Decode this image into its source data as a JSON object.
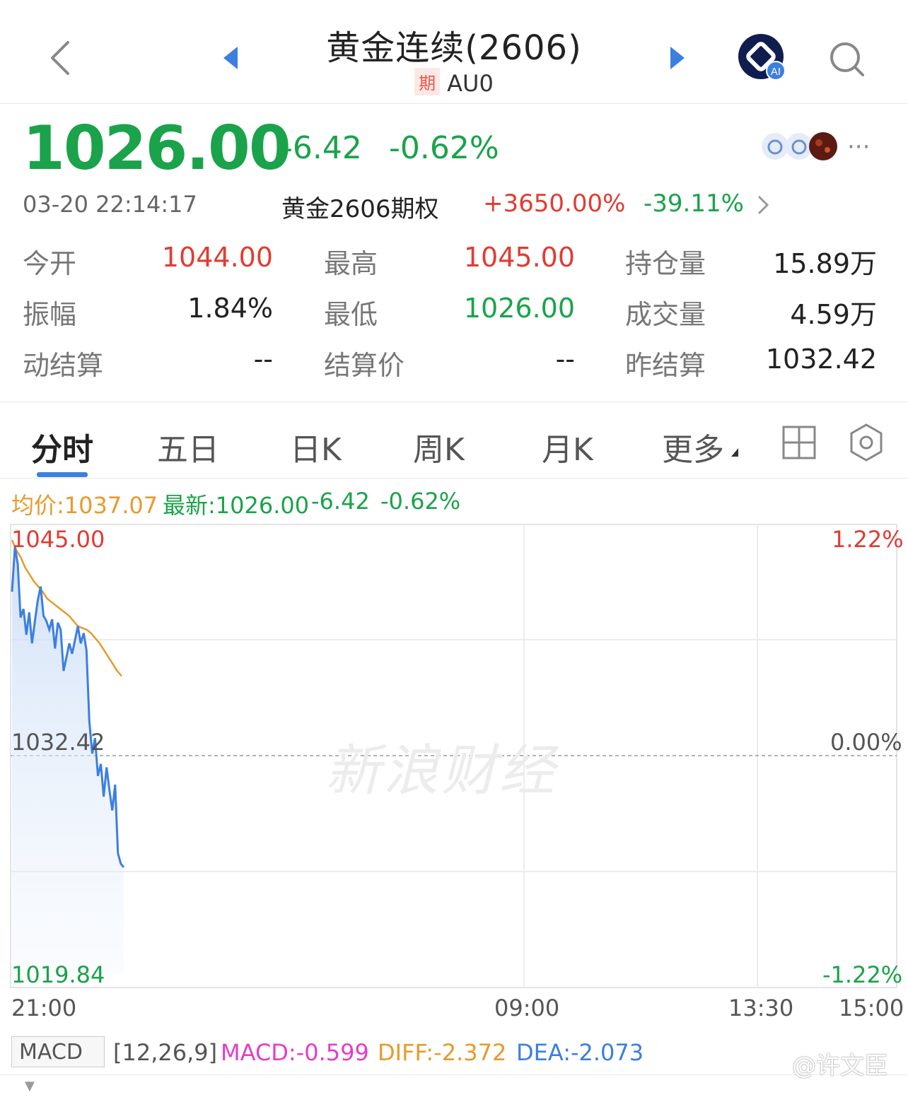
{
  "header": {
    "title": "黄金连续(2606)",
    "badge": "期",
    "code": "AU0"
  },
  "quote": {
    "price": "1026.00",
    "change": "-6.42",
    "change_pct": "-0.62%",
    "time": "03-20 22:14:17",
    "option_name": "黄金2606期权",
    "option_up": "+3650.00%",
    "option_down": "-39.11%"
  },
  "stats": [
    {
      "label": "今开",
      "value": "1044.00",
      "color": "#e23b32"
    },
    {
      "label": "最高",
      "value": "1045.00",
      "color": "#e23b32"
    },
    {
      "label": "持仓量",
      "value": "15.89万",
      "color": "#222222"
    },
    {
      "label": "振幅",
      "value": "1.84%",
      "color": "#222222"
    },
    {
      "label": "最低",
      "value": "1026.00",
      "color": "#1aa34a"
    },
    {
      "label": "成交量",
      "value": "4.59万",
      "color": "#222222"
    },
    {
      "label": "动结算",
      "value": "--",
      "color": "#222222"
    },
    {
      "label": "结算价",
      "value": "--",
      "color": "#222222"
    },
    {
      "label": "昨结算",
      "value": "1032.42",
      "color": "#222222"
    }
  ],
  "tabs": [
    "分时",
    "五日",
    "日K",
    "周K",
    "月K",
    "更多"
  ],
  "legend": {
    "avg": "均价:1037.07",
    "latest": "最新:1026.00",
    "change": "-6.42",
    "change_pct": "-0.62%"
  },
  "axis": {
    "top_price": "1045.00",
    "mid_price": "1032.42",
    "bottom_price": "1019.84",
    "top_pct": "1.22%",
    "mid_pct": "0.00%",
    "bottom_pct": "-1.22%",
    "times": [
      "21:00",
      "09:00",
      "13:30",
      "15:00"
    ]
  },
  "watermark": "新浪财经",
  "macd": {
    "selector": "MACD",
    "params": "[12,26,9]",
    "macd": "MACD:-0.599",
    "diff": "DIFF:-2.372",
    "dea": "DEA:-2.073"
  },
  "credit": "@许文臣",
  "chart_data": {
    "type": "line",
    "ylim": [
      1019.84,
      1045.0
    ],
    "series": [
      {
        "values": [
          1042.0,
          1044.6,
          1043.6,
          1040.5,
          1041.0,
          1039.5,
          1040.8,
          1039.0,
          1040.3,
          1041.5,
          1042.3,
          1040.6,
          1040.3,
          1039.8,
          1040.4,
          1038.7,
          1040.2,
          1039.8,
          1037.4,
          1038.2,
          1039.0,
          1038.4,
          1039.2,
          1040.0,
          1039.0,
          1039.6,
          1038.6,
          1034.5,
          1032.6,
          1033.5,
          1031.3,
          1032.0,
          1030.1,
          1031.8,
          1030.5,
          1029.3,
          1030.8,
          1026.8,
          1026.2,
          1026.0
        ]
      },
      {
        "values": [
          1045.0,
          1044.4,
          1044.0,
          1043.4,
          1043.0,
          1042.6,
          1042.3,
          1042.0,
          1041.6,
          1041.4,
          1041.2,
          1041.0,
          1040.8,
          1040.6,
          1040.3,
          1040.0,
          1039.9,
          1039.8,
          1039.6,
          1039.3,
          1039.0,
          1038.6,
          1038.2,
          1037.8,
          1037.4,
          1037.1
        ]
      }
    ]
  }
}
